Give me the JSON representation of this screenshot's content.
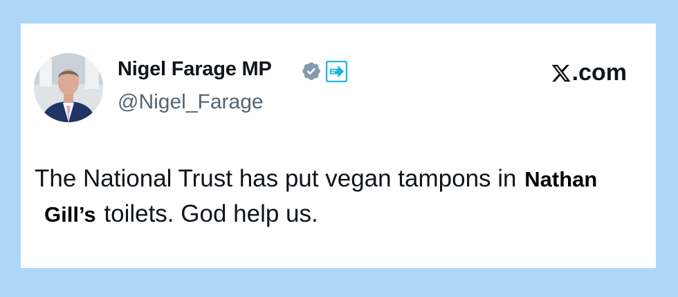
{
  "author": {
    "display_name": "Nigel Farage MP",
    "handle": "@Nigel_Farage",
    "avatar_icon": "profile-photo-icon",
    "verified_icon": "verified-badge-icon",
    "affiliation_icon": "reform-uk-affiliation-icon"
  },
  "brand": {
    "label": ".com"
  },
  "tweet": {
    "line1_text": "The National Trust has put vegan tampons in ",
    "line1_overlay": "Nathan",
    "line2_overlay": "Gill’s",
    "line2_text": " toilets. God help us."
  },
  "colors": {
    "background": "#aed6f7",
    "card": "#ffffff",
    "text_primary": "#0f1419",
    "text_secondary": "#536471",
    "verified_badge": "#829aab",
    "affiliation_badge": "#12b6de"
  }
}
